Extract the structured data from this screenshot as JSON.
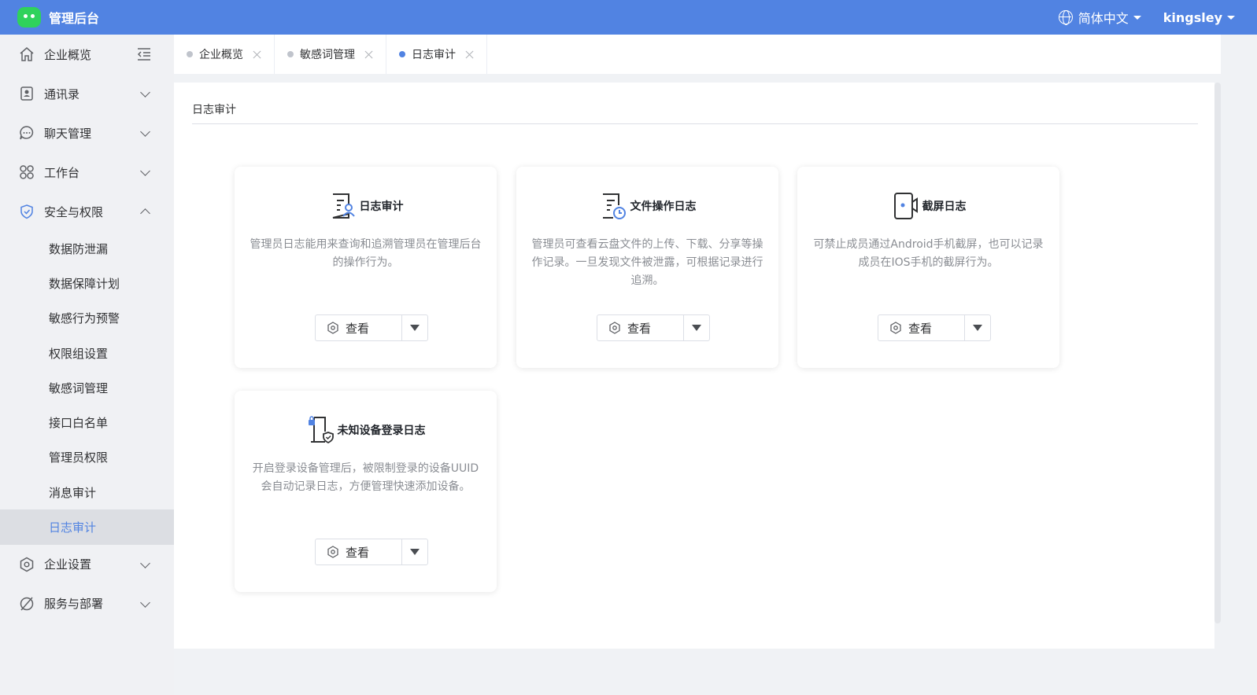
{
  "app": {
    "title": "管理后台"
  },
  "header": {
    "language": "简体中文",
    "user": "kingsley"
  },
  "sidebar": {
    "items": [
      {
        "label": "企业概览",
        "icon": "home-icon"
      },
      {
        "label": "通讯录",
        "icon": "contacts-icon"
      },
      {
        "label": "聊天管理",
        "icon": "chat-icon"
      },
      {
        "label": "工作台",
        "icon": "workbench-icon"
      },
      {
        "label": "安全与权限",
        "icon": "shield-icon"
      },
      {
        "label": "企业设置",
        "icon": "settings-icon"
      },
      {
        "label": "服务与部署",
        "icon": "service-icon"
      }
    ],
    "security_sub": [
      {
        "label": "数据防泄漏"
      },
      {
        "label": "数据保障计划"
      },
      {
        "label": "敏感行为预警"
      },
      {
        "label": "权限组设置"
      },
      {
        "label": "敏感词管理"
      },
      {
        "label": "接口白名单"
      },
      {
        "label": "管理员权限"
      },
      {
        "label": "消息审计"
      },
      {
        "label": "日志审计",
        "active": true
      }
    ]
  },
  "tabs": [
    {
      "label": "企业概览"
    },
    {
      "label": "敏感词管理"
    },
    {
      "label": "日志审计",
      "active": true
    }
  ],
  "main": {
    "title": "日志审计",
    "cards": [
      {
        "title": "日志审计",
        "desc": "管理员日志能用来查询和追溯管理员在管理后台的操作行为。",
        "button": "查看",
        "icon": "audit-log-icon"
      },
      {
        "title": "文件操作日志",
        "desc": "管理员可查看云盘文件的上传、下载、分享等操作记录。一旦发现文件被泄露，可根据记录进行追溯。",
        "button": "查看",
        "icon": "file-log-icon"
      },
      {
        "title": "截屏日志",
        "desc": "可禁止成员通过Android手机截屏，也可以记录成员在IOS手机的截屏行为。",
        "button": "查看",
        "icon": "screenshot-log-icon"
      },
      {
        "title": "未知设备登录日志",
        "desc": "开启登录设备管理后，被限制登录的设备UUID会自动记录日志，方便管理快速添加设备。",
        "button": "查看",
        "icon": "device-log-icon"
      }
    ]
  },
  "colors": {
    "header": "#5183e2",
    "accent": "#5183e2",
    "logo": "#2fd25c"
  }
}
